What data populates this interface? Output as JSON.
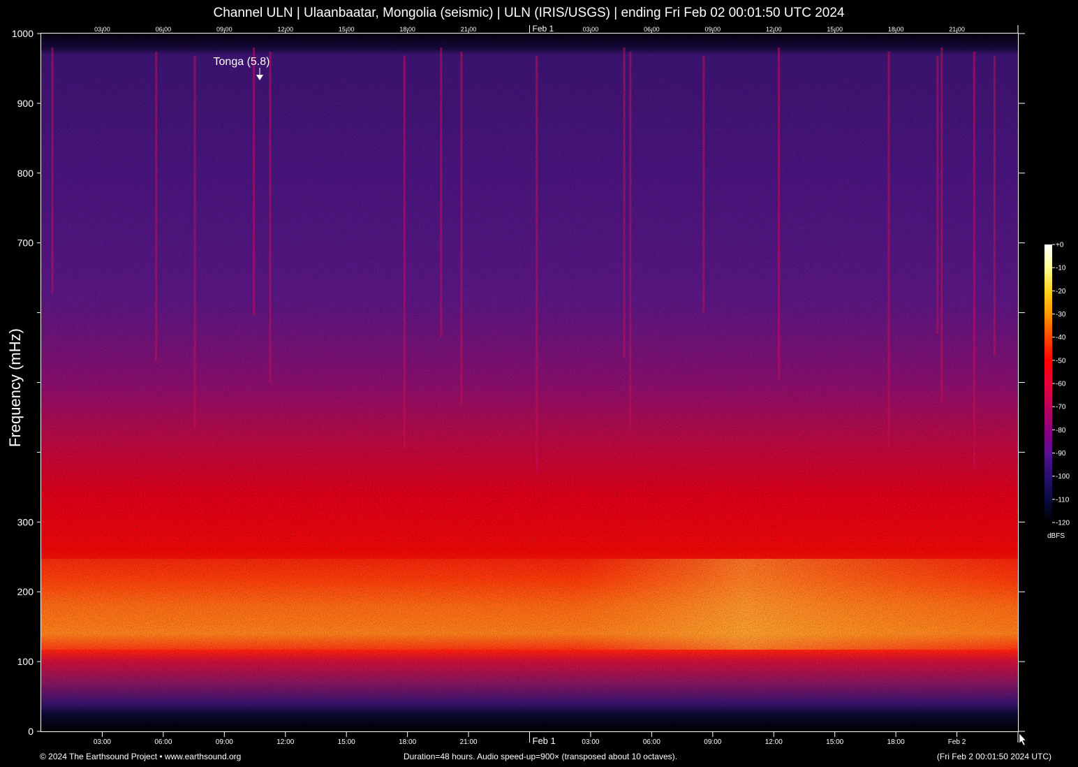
{
  "chart_data": {
    "type": "heatmap",
    "title": "Channel ULN | Ulaanbaatar, Mongolia (seismic) | ULN (IRIS/USGS) | ending Fri Feb 02 00:01:50 UTC 2024",
    "ylabel": "Frequency (mHz)",
    "ylim": [
      0,
      1000
    ],
    "y_tick_labels": [
      "0",
      "100",
      "200",
      "300",
      "700",
      "800",
      "900",
      "1000"
    ],
    "x_tick_labels_bottom": [
      "03:00",
      "06:00",
      "09:00",
      "12:00",
      "15:00",
      "18:00",
      "21:00",
      "Feb  1",
      "03:00",
      "06:00",
      "09:00",
      "12:00",
      "15:00",
      "18:00",
      "Feb  2"
    ],
    "x_tick_labels_top": [
      "03:00",
      "06:00",
      "09:00",
      "12:00",
      "15:00",
      "18:00",
      "21:00",
      "Feb  1",
      "03:00",
      "06:00",
      "09:00",
      "12:00",
      "15:00",
      "18:00",
      "21:00"
    ],
    "annotation": "Tonga (5.8)",
    "colorbar": {
      "unit": "dBFS",
      "ticks": [
        "+0",
        "-10",
        "-20",
        "-30",
        "-40",
        "-50",
        "-60",
        "-70",
        "-80",
        "-90",
        "-100",
        "-110",
        "-120"
      ],
      "colors": [
        "#ffffff",
        "#ffff9a",
        "#ffd11a",
        "#ff9a00",
        "#ff4a00",
        "#ff0000",
        "#e8003a",
        "#c0005a",
        "#8a0080",
        "#5a1090",
        "#2a1070",
        "#0a0a40",
        "#000000"
      ]
    }
  },
  "footer": {
    "left": "© 2024 The Earthsound Project • www.earthsound.org",
    "center": "Duration=48 hours. Audio speed-up=900× (transposed about 10 octaves).",
    "right": "(Fri Feb  2 00:01:50 2024 UTC)"
  }
}
